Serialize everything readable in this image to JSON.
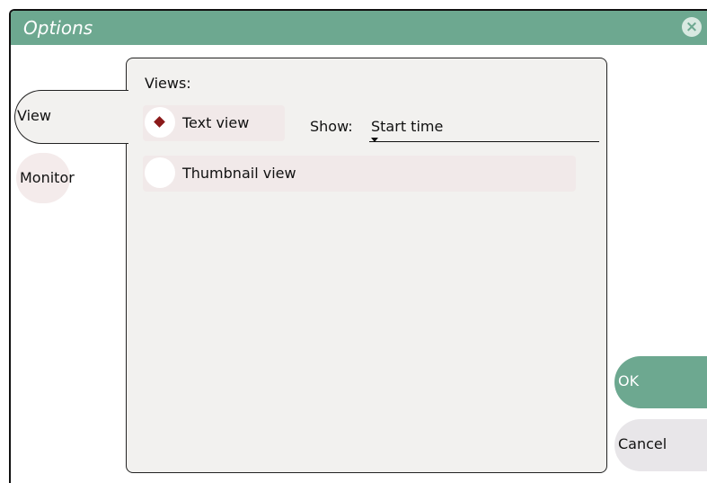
{
  "window": {
    "title": "Options"
  },
  "tabs": [
    {
      "label": "View",
      "active": true
    },
    {
      "label": "Monitor",
      "active": false
    }
  ],
  "views": {
    "heading": "Views:",
    "options": [
      {
        "label": "Text view",
        "selected": true
      },
      {
        "label": "Thumbnail view",
        "selected": false
      }
    ],
    "show": {
      "label": "Show:",
      "value": "Start time"
    }
  },
  "buttons": {
    "ok": "OK",
    "cancel": "Cancel"
  },
  "colors": {
    "accent": "#6da890",
    "radio_dot": "#8b1a1a",
    "panel": "#f2f1ef"
  }
}
